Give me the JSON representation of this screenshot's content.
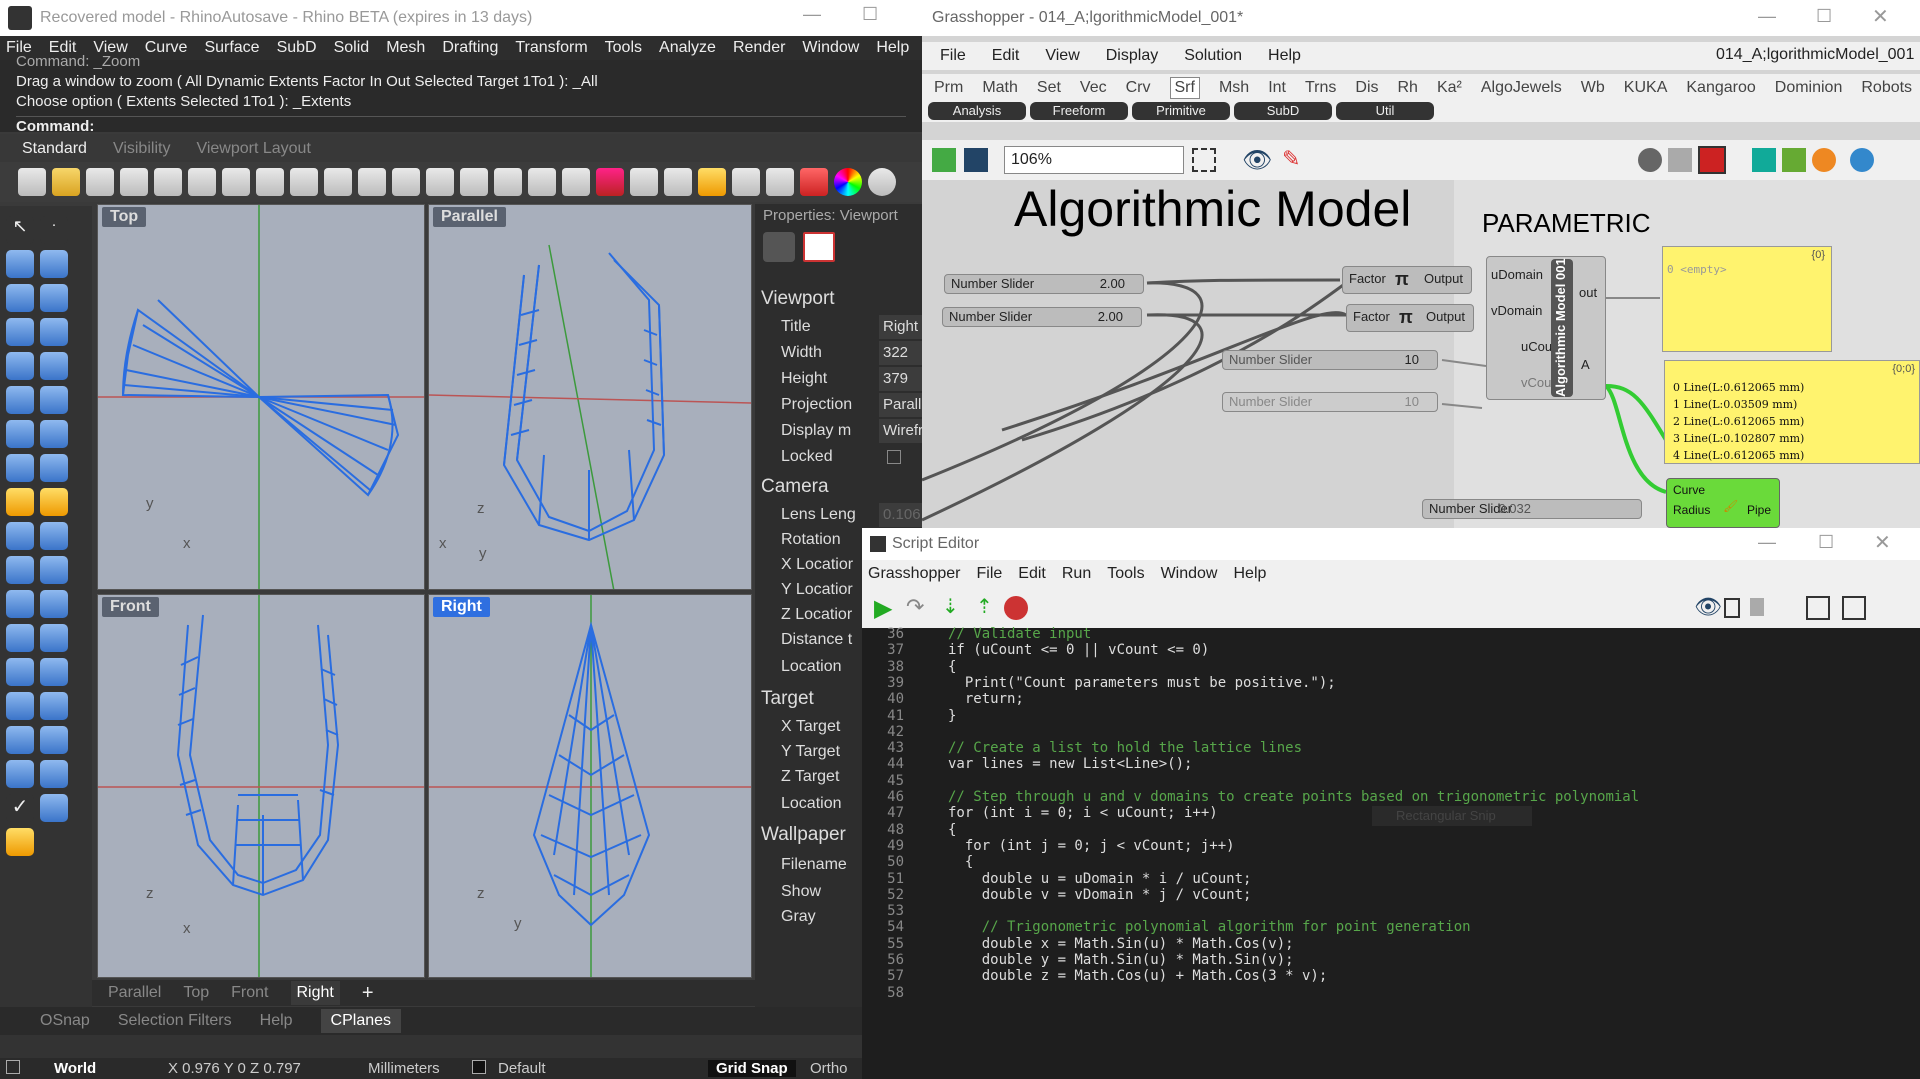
{
  "rhino": {
    "title": "Recovered model - RhinoAutosave - Rhino BETA (expires in 13 days)",
    "menu": [
      "File",
      "Edit",
      "View",
      "Curve",
      "Surface",
      "SubD",
      "Solid",
      "Mesh",
      "Drafting",
      "Transform",
      "Tools",
      "Analyze",
      "Render",
      "Window",
      "Help"
    ],
    "command_history": [
      "Command: _Zoom",
      "Drag a window to zoom ( All  Dynamic  Extents  Factor  In  Out  Selected  Target  1To1 ): _All",
      "Choose option ( Extents  Selected  1To1 ): _Extents"
    ],
    "command_prompt": "Command:",
    "toolbar_tabs": [
      "Standard",
      "Visibility",
      "Viewport Layout"
    ],
    "viewports": [
      {
        "label": "Top",
        "axis_v": "y",
        "axis_h": "x"
      },
      {
        "label": "Parallel",
        "axis_v": "z",
        "axis_h": "x",
        "axis_h2": "y"
      },
      {
        "label": "Front",
        "axis_v": "z",
        "axis_h": "x"
      },
      {
        "label": "Right",
        "axis_v": "z",
        "axis_h": "y"
      }
    ],
    "properties": {
      "header": "Properties: Viewport",
      "viewport_heading": "Viewport",
      "rows": [
        {
          "label": "Title",
          "value": "Right"
        },
        {
          "label": "Width",
          "value": "322"
        },
        {
          "label": "Height",
          "value": "379"
        },
        {
          "label": "Projection",
          "value": "Paralle"
        },
        {
          "label": "Display m",
          "value": "Wirefr"
        },
        {
          "label": "Locked",
          "value": ""
        }
      ],
      "camera_heading": "Camera",
      "camera_rows": [
        "Lens Leng",
        "Rotation",
        "X Locatior",
        "Y Locatior",
        "Z Locatior",
        "Distance t",
        "Location"
      ],
      "lens_value": "0.106",
      "target_heading": "Target",
      "target_rows": [
        "X Target",
        "Y Target",
        "Z Target",
        "Location"
      ],
      "wallpaper_heading": "Wallpaper",
      "wallpaper_rows": [
        "Filename",
        "Show",
        "Gray"
      ]
    },
    "viewport_tabs": [
      "Parallel",
      "Top",
      "Front",
      "Right"
    ],
    "snap_tabs": [
      "OSnap",
      "Selection Filters",
      "Help",
      "CPlanes"
    ],
    "status": {
      "cplane": "World",
      "coords": "X 0.976 Y 0 Z 0.797",
      "units": "Millimeters",
      "layer": "Default",
      "grid_snap": "Grid Snap",
      "ortho": "Ortho"
    }
  },
  "gh": {
    "title": "Grasshopper - 014_A;lgorithmicModel_001*",
    "doc_name": "014_A;lgorithmicModel_001",
    "menu": [
      "File",
      "Edit",
      "View",
      "Display",
      "Solution",
      "Help"
    ],
    "tabs": [
      "Prm",
      "Math",
      "Set",
      "Vec",
      "Crv",
      "Srf",
      "Msh",
      "Int",
      "Trns",
      "Dis",
      "Rh",
      "Ka²",
      "AlgoJewels",
      "Wb",
      "KUKA",
      "Kangaroo",
      "Dominion",
      "Robots"
    ],
    "subtabs": [
      "Analysis",
      "Freeform",
      "Primitive",
      "SubD",
      "Util"
    ],
    "zoom": "106%",
    "heading": "Algorithmic Model",
    "subheading": "PARAMETRIC",
    "sliders": [
      {
        "label": "Number Slider",
        "value": "2.00"
      },
      {
        "label": "Number Slider",
        "value": "2.00"
      },
      {
        "label": "Number Slider",
        "value": "10"
      },
      {
        "label": "Number Slider",
        "value": "10"
      },
      {
        "label": "Number Slider",
        "value": "0.032"
      }
    ],
    "factor": {
      "in": "Factor",
      "out": "Output"
    },
    "component": {
      "name": "Algorithmic Model 001",
      "inputs": [
        "uDomain",
        "vDomain",
        "uCount",
        "vCount"
      ],
      "outputs": [
        "out",
        "A"
      ]
    },
    "panel1": {
      "path": "{0}",
      "content": "0 <empty>"
    },
    "panel2": {
      "path": "{0;0}",
      "lines": [
        "0 Line(L:0.612065 mm)",
        "1 Line(L:0.03509 mm)",
        "2 Line(L:0.612065 mm)",
        "3 Line(L:0.102807 mm)",
        "4 Line(L:0.612065 mm)"
      ]
    },
    "pipe": {
      "in1": "Curve",
      "in2": "Radius",
      "out": "Pipe"
    }
  },
  "se": {
    "title": "Script Editor",
    "menu": [
      "Grasshopper",
      "File",
      "Edit",
      "Run",
      "Tools",
      "Window",
      "Help"
    ],
    "hint": "Rectangular Snip",
    "line_numbers": [
      "36",
      "37",
      "38",
      "39",
      "40",
      "41",
      "42",
      "43",
      "44",
      "45",
      "46",
      "47",
      "48",
      "49",
      "50",
      "51",
      "52",
      "53",
      "54",
      "55",
      "56",
      "57",
      "58"
    ],
    "code": [
      "// Validate input",
      "if (uCount <= 0 || vCount <= 0)",
      "{",
      "  Print(\"Count parameters must be positive.\");",
      "  return;",
      "}",
      "",
      "// Create a list to hold the lattice lines",
      "var lines = new List<Line>();",
      "",
      "// Step through u and v domains to create points based on trigonometric polynomial",
      "for (int i = 0; i < uCount; i++)",
      "{",
      "  for (int j = 0; j < vCount; j++)",
      "  {",
      "    double u = uDomain * i / uCount;",
      "    double v = vDomain * j / vCount;",
      "",
      "    // Trigonometric polynomial algorithm for point generation",
      "    double x = Math.Sin(u) * Math.Cos(v);",
      "    double y = Math.Sin(u) * Math.Sin(v);",
      "    double z = Math.Cos(u) + Math.Cos(3 * v);",
      ""
    ]
  }
}
